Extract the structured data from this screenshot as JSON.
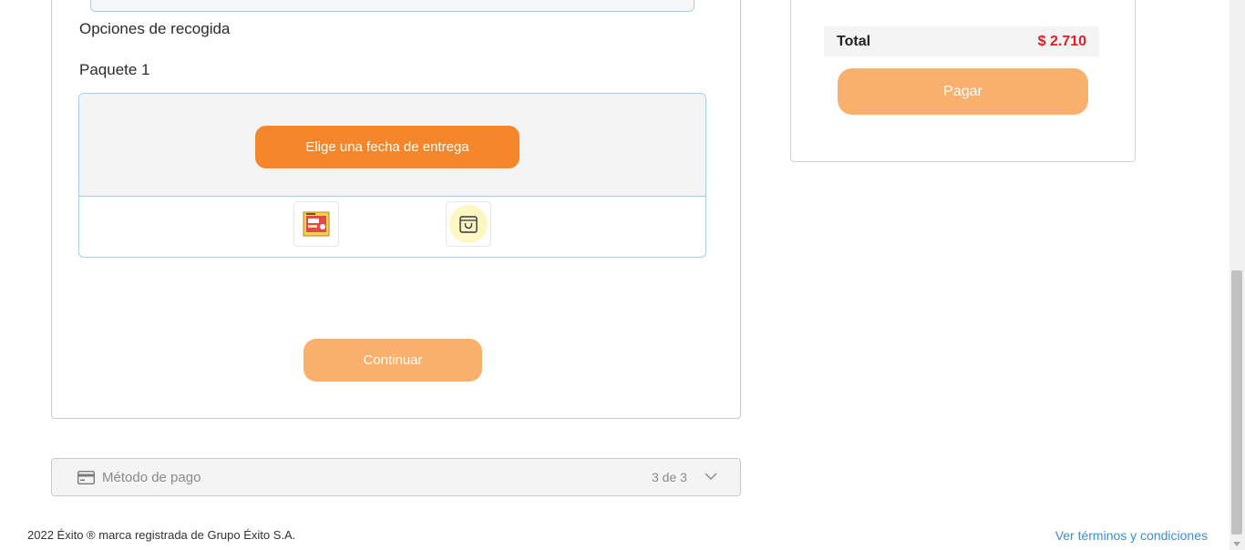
{
  "pickup": {
    "section_title": "Opciones de recogida",
    "package_title": "Paquete 1",
    "date_button_label": "Elige una fecha de entrega",
    "thumbnails": [
      {
        "icon": "product-thumbnail-icon"
      },
      {
        "icon": "shopping-bag-icon"
      }
    ],
    "continue_label": "Continuar"
  },
  "payment_method": {
    "icon": "credit-card-icon",
    "label": "Método de pago",
    "step": "3 de 3",
    "expand_icon": "chevron-down-icon"
  },
  "summary": {
    "total_label": "Total",
    "total_value": "$ 2.710",
    "pay_label": "Pagar"
  },
  "footer": {
    "copyright": "2022 Éxito ® marca registrada de Grupo Éxito S.A.",
    "terms_link": "Ver términos y condiciones"
  },
  "colors": {
    "primary_orange": "#f5862a",
    "disabled_orange": "#f9b06d",
    "price_red": "#e21c23",
    "link_blue": "#3b8ed3",
    "border_blue": "#a7cde6"
  }
}
